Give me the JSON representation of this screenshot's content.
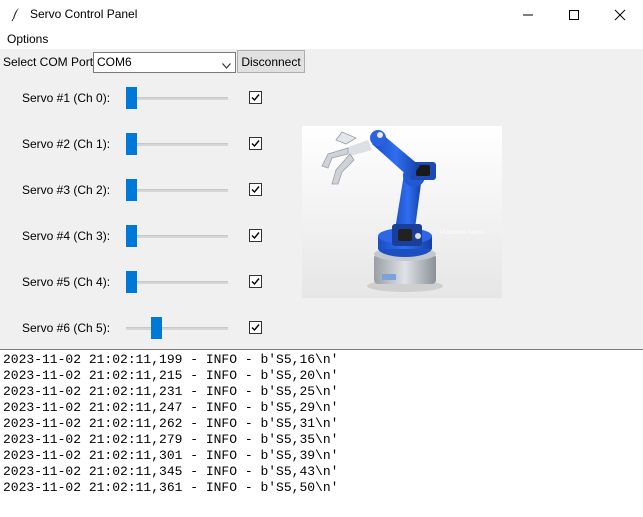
{
  "window": {
    "title": "Servo Control Panel"
  },
  "menu": {
    "options": "Options"
  },
  "com": {
    "label": "Select COM Port:",
    "value": "COM6",
    "disconnect_label": "Disconnect"
  },
  "servos": [
    {
      "label": "Servo #1 (Ch 0):",
      "value_fraction": 0.0,
      "enabled": true
    },
    {
      "label": "Servo #2 (Ch 1):",
      "value_fraction": 0.0,
      "enabled": true
    },
    {
      "label": "Servo #3 (Ch 2):",
      "value_fraction": 0.0,
      "enabled": true
    },
    {
      "label": "Servo #4 (Ch 3):",
      "value_fraction": 0.0,
      "enabled": true
    },
    {
      "label": "Servo #5 (Ch 4):",
      "value_fraction": 0.0,
      "enabled": true
    },
    {
      "label": "Servo #6 (Ch 5):",
      "value_fraction": 0.28,
      "enabled": true
    }
  ],
  "robot_image": {
    "watermark": "PCB3000 Servo"
  },
  "log": [
    "2023-11-02 21:02:11,199 - INFO - b'S5,16\\n'",
    "2023-11-02 21:02:11,215 - INFO - b'S5,20\\n'",
    "2023-11-02 21:02:11,231 - INFO - b'S5,25\\n'",
    "2023-11-02 21:02:11,247 - INFO - b'S5,29\\n'",
    "2023-11-02 21:02:11,262 - INFO - b'S5,31\\n'",
    "2023-11-02 21:02:11,279 - INFO - b'S5,35\\n'",
    "2023-11-02 21:02:11,301 - INFO - b'S5,39\\n'",
    "2023-11-02 21:02:11,345 - INFO - b'S5,43\\n'",
    "2023-11-02 21:02:11,361 - INFO - b'S5,50\\n'"
  ],
  "colors": {
    "accent": "#0078d7",
    "robot_blue": "#1f5fd6"
  },
  "icons": {
    "app": "feather-icon",
    "minimize": "minimize-icon",
    "maximize": "maximize-icon",
    "close": "close-icon"
  }
}
